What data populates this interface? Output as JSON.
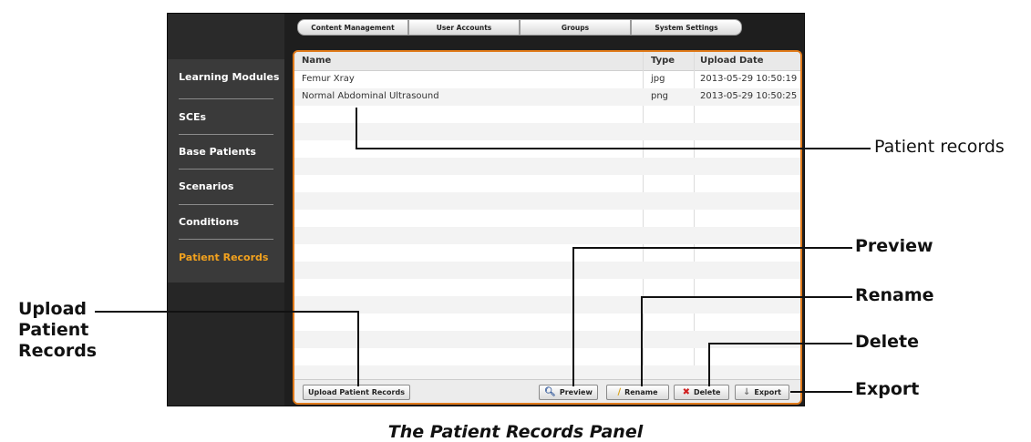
{
  "tabs": [
    "Content Management",
    "User Accounts",
    "Groups",
    "System Settings"
  ],
  "sidebar": {
    "items": [
      {
        "label": "Learning Modules"
      },
      {
        "label": "SCEs"
      },
      {
        "label": "Base Patients"
      },
      {
        "label": "Scenarios"
      },
      {
        "label": "Conditions"
      },
      {
        "label": "Patient Records",
        "active": true
      }
    ]
  },
  "table": {
    "headers": {
      "name": "Name",
      "type": "Type",
      "date": "Upload Date"
    },
    "rows": [
      {
        "name": "Femur Xray",
        "type": "jpg",
        "date": "2013-05-29 10:50:19"
      },
      {
        "name": "Normal Abdominal Ultrasound",
        "type": "png",
        "date": "2013-05-29 10:50:25"
      }
    ]
  },
  "buttons": {
    "upload": "Upload Patient Records",
    "preview": "Preview",
    "rename": "Rename",
    "delete": "Delete",
    "export": "Export"
  },
  "callouts": {
    "patient_records": "Patient records",
    "preview": "Preview",
    "rename": "Rename",
    "delete": "Delete",
    "export": "Export",
    "upload_line1": "Upload",
    "upload_line2": "Patient",
    "upload_line3": "Records"
  },
  "caption": "The Patient Records Panel",
  "colors": {
    "accent": "#e07a1a",
    "active_menu": "#f3a21e"
  }
}
